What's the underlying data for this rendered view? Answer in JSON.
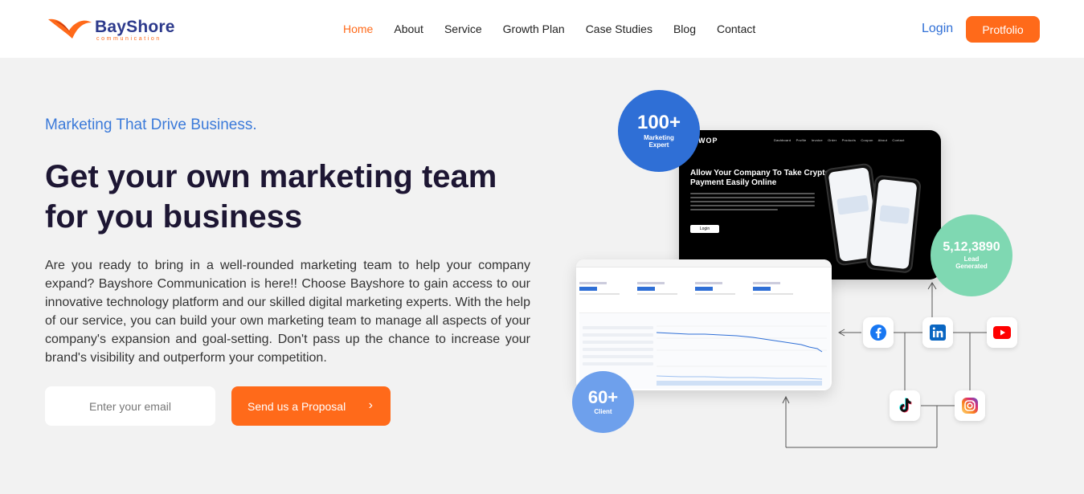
{
  "brand": {
    "name": "BayShore",
    "sub": "communication"
  },
  "nav": {
    "items": [
      "Home",
      "About",
      "Service",
      "Growth Plan",
      "Case Studies",
      "Blog",
      "Contact"
    ],
    "active": "Home"
  },
  "header": {
    "login_label": "Login",
    "portfolio_label": "Protfolio"
  },
  "hero": {
    "tagline": "Marketing That Drive Business.",
    "headline": "Get your own marketing team for you business",
    "body": "Are you ready to bring in a well-rounded marketing team to help your company expand? Bayshore Communication is here!! Choose Bayshore to gain access to our innovative technology platform and our skilled digital marketing experts. With the help of our service, you can build your own marketing team to manage all aspects of your company's expansion and goal-setting. Don't pass up the chance to increase your brand's visibility and outperform your competition.",
    "email_placeholder": "Enter your email",
    "cta_label": "Send us a Proposal",
    "cta_icon": "chevron-right-icon"
  },
  "stats": {
    "marketing": {
      "value": "100+",
      "label": "Marketing Expert"
    },
    "leads": {
      "value": "5,12,3890",
      "label": "Lead Generated"
    },
    "clients": {
      "value": "60+",
      "label": "Client"
    }
  },
  "preview_dark": {
    "brand": "WOP",
    "nav": "Dashboard Profile Invoice Order Products Coupon About Contact",
    "title": "Allow Your Company To Take Crypto Payment Easily Online",
    "button": "Login"
  },
  "socials": [
    "facebook-icon",
    "linkedin-icon",
    "youtube-icon",
    "tiktok-icon",
    "instagram-icon"
  ],
  "colors": {
    "accent": "#ff6a1a",
    "primary": "#2f6fd6",
    "heading": "#1d1633",
    "lead_bubble": "#7fd8b2",
    "client_bubble": "#6ea0ec"
  }
}
